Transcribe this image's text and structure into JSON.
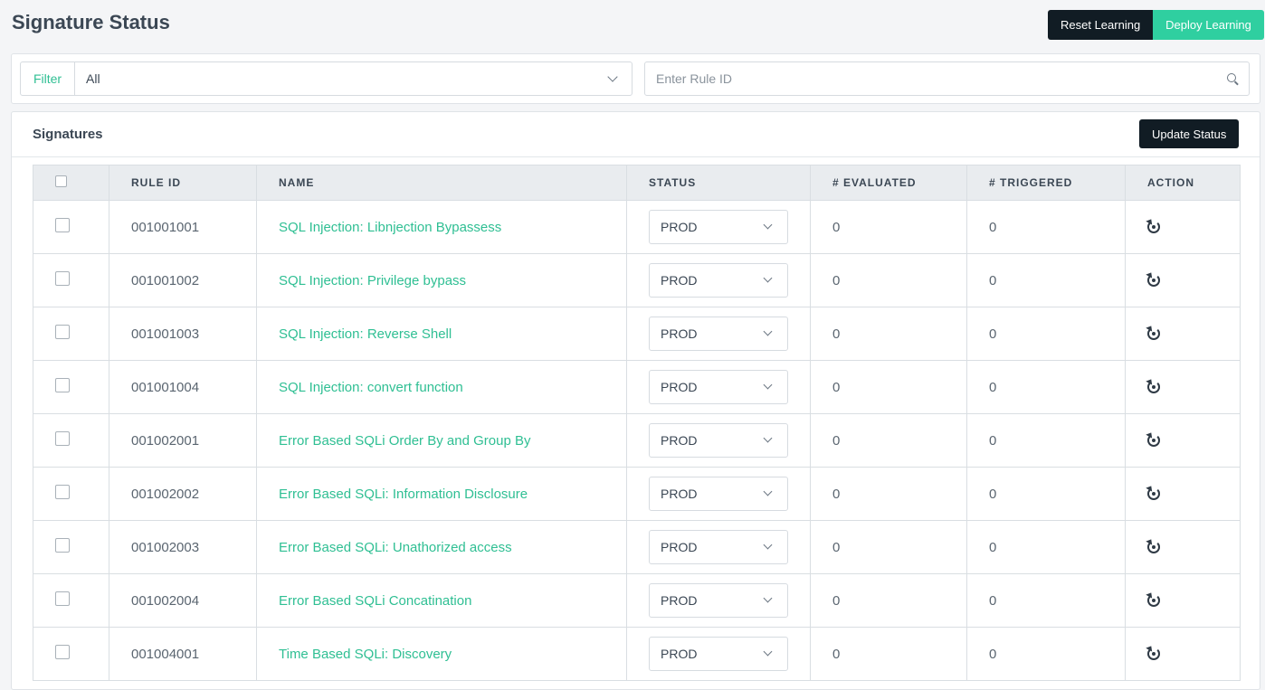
{
  "page_title": "Signature Status",
  "header_actions": {
    "reset_label": "Reset Learning",
    "deploy_label": "Deploy Learning"
  },
  "filter": {
    "label": "Filter",
    "selected": "All",
    "search_placeholder": "Enter Rule ID"
  },
  "signatures": {
    "title": "Signatures",
    "update_button": "Update Status",
    "columns": [
      "RULE ID",
      "NAME",
      "STATUS",
      "# EVALUATED",
      "# TRIGGERED",
      "ACTION"
    ],
    "rows": [
      {
        "rule_id": "001001001",
        "name": "SQL Injection: Libnjection Bypassess",
        "status": "PROD",
        "evaluated": "0",
        "triggered": "0"
      },
      {
        "rule_id": "001001002",
        "name": "SQL Injection: Privilege bypass",
        "status": "PROD",
        "evaluated": "0",
        "triggered": "0"
      },
      {
        "rule_id": "001001003",
        "name": "SQL Injection: Reverse Shell",
        "status": "PROD",
        "evaluated": "0",
        "triggered": "0"
      },
      {
        "rule_id": "001001004",
        "name": "SQL Injection: convert function",
        "status": "PROD",
        "evaluated": "0",
        "triggered": "0"
      },
      {
        "rule_id": "001002001",
        "name": "Error Based SQLi Order By and Group By",
        "status": "PROD",
        "evaluated": "0",
        "triggered": "0"
      },
      {
        "rule_id": "001002002",
        "name": "Error Based SQLi: Information Disclosure",
        "status": "PROD",
        "evaluated": "0",
        "triggered": "0"
      },
      {
        "rule_id": "001002003",
        "name": "Error Based SQLi: Unathorized access",
        "status": "PROD",
        "evaluated": "0",
        "triggered": "0"
      },
      {
        "rule_id": "001002004",
        "name": "Error Based SQLi Concatination",
        "status": "PROD",
        "evaluated": "0",
        "triggered": "0"
      },
      {
        "rule_id": "001004001",
        "name": "Time Based SQLi: Discovery",
        "status": "PROD",
        "evaluated": "0",
        "triggered": "0"
      }
    ]
  },
  "icons": {
    "search": "search-icon",
    "dropdown": "chevron-down-icon",
    "action": "reset-icon"
  },
  "colors": {
    "accent": "#2fcfa0",
    "dark_button": "#111c24"
  }
}
